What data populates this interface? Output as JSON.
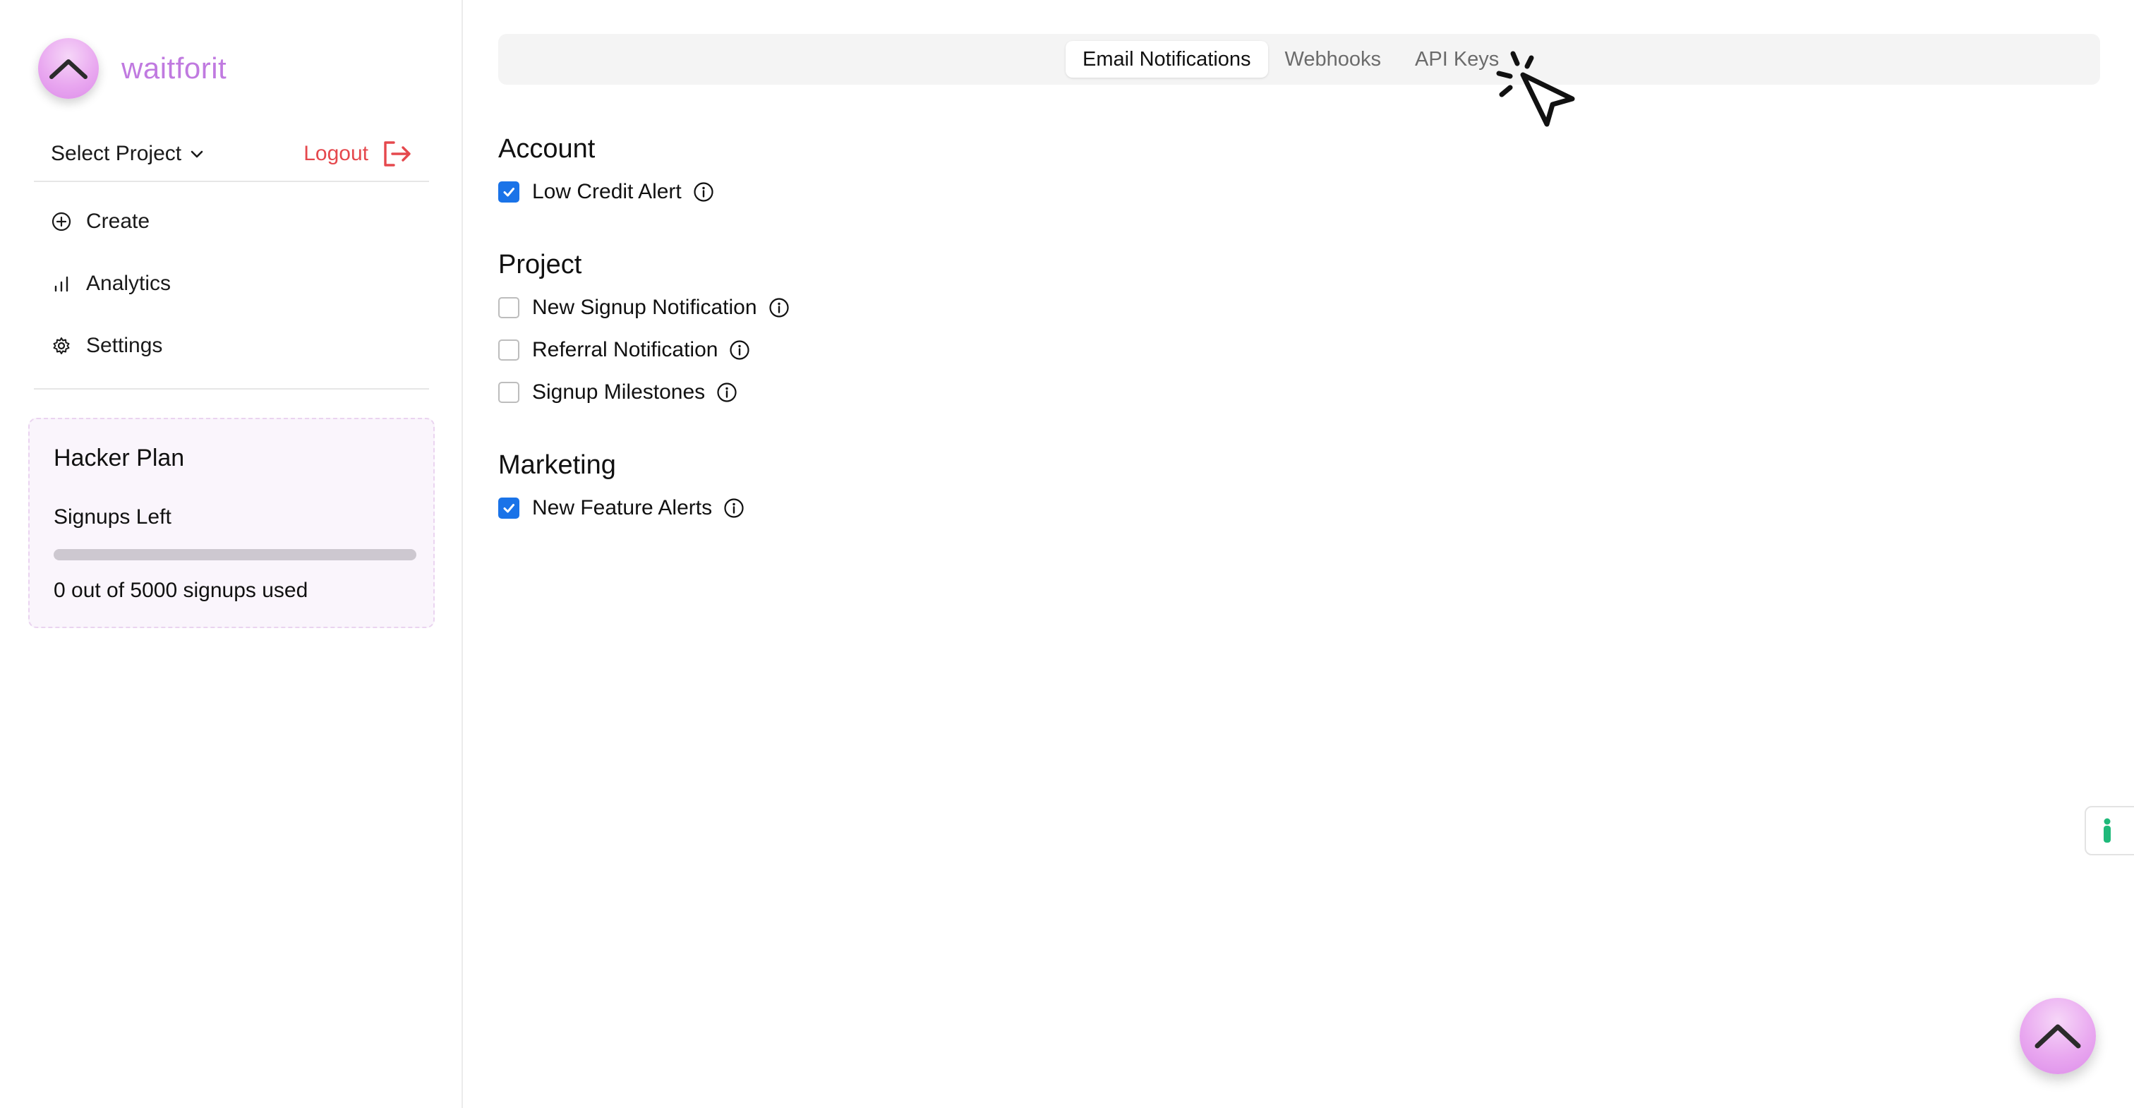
{
  "brand": {
    "name": "waitforit",
    "accent": "#c07ae0"
  },
  "sidebar": {
    "project_select": {
      "label": "Select Project",
      "icon": "chevron-down-icon"
    },
    "logout": {
      "label": "Logout",
      "icon": "logout-icon",
      "color": "#e5484d"
    },
    "nav": [
      {
        "label": "Create",
        "icon": "plus-circle-icon"
      },
      {
        "label": "Analytics",
        "icon": "bar-chart-icon"
      },
      {
        "label": "Settings",
        "icon": "gear-icon"
      }
    ],
    "plan": {
      "title": "Hacker Plan",
      "signups_label": "Signups Left",
      "used": 0,
      "total": 5000,
      "usage_text": "0 out of 5000 signups used"
    }
  },
  "tabs": [
    {
      "label": "Email Notifications",
      "active": true
    },
    {
      "label": "Webhooks",
      "active": false
    },
    {
      "label": "API Keys",
      "active": false
    }
  ],
  "sections": [
    {
      "title": "Account",
      "options": [
        {
          "label": "Low Credit Alert",
          "checked": true
        }
      ]
    },
    {
      "title": "Project",
      "options": [
        {
          "label": "New Signup Notification",
          "checked": false
        },
        {
          "label": "Referral Notification",
          "checked": false
        },
        {
          "label": "Signup Milestones",
          "checked": false
        }
      ]
    },
    {
      "title": "Marketing",
      "options": [
        {
          "label": "New Feature Alerts",
          "checked": true
        }
      ]
    }
  ],
  "colors": {
    "checkbox_checked": "#1a73e8",
    "side_tab_icon": "#1fb97a"
  }
}
